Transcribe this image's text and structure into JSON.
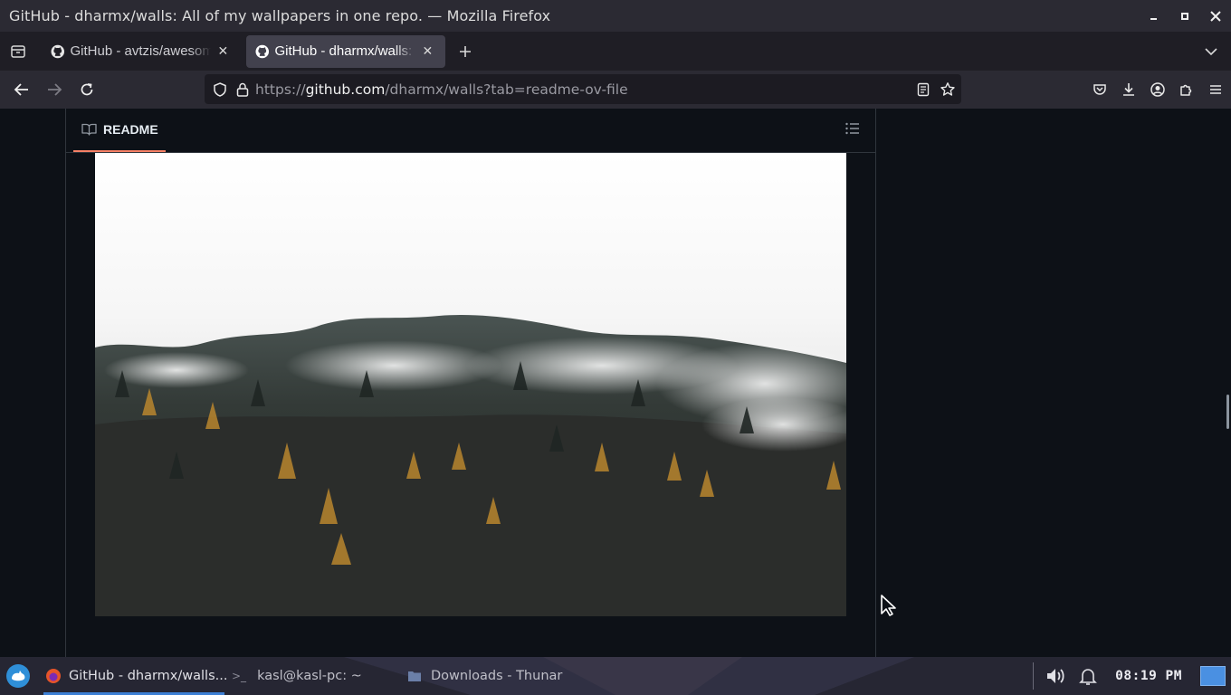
{
  "window": {
    "title": "GitHub - dharmx/walls: All of my wallpapers in one repo. — Mozilla Firefox",
    "controls": [
      "minimize",
      "maximize",
      "close"
    ]
  },
  "tabs": [
    {
      "label": "GitHub - avtzis/awesome-linux-ricing",
      "active": false
    },
    {
      "label": "GitHub - dharmx/walls: All of my wallpapers",
      "active": true
    }
  ],
  "navbar": {
    "url_prefix": "https://",
    "url_host": "github.com",
    "url_path": "/dharmx/walls?tab=readme-ov-file"
  },
  "readme": {
    "tab_label": "README"
  },
  "wallpaper": {
    "description_icon": "image",
    "sky_color": "#f4f4f4",
    "forest_color": "#2a2d2b"
  },
  "taskbar": {
    "items": [
      {
        "label": "GitHub - dharmx/walls...",
        "icon": "firefox-icon",
        "active": true
      },
      {
        "label": "kasl@kasl-pc: ~",
        "icon": "terminal-icon",
        "active": false
      },
      {
        "label": "Downloads - Thunar",
        "icon": "folder-icon",
        "active": false
      }
    ],
    "clock": "08:19 PM",
    "accent": "#3d7fd4"
  }
}
